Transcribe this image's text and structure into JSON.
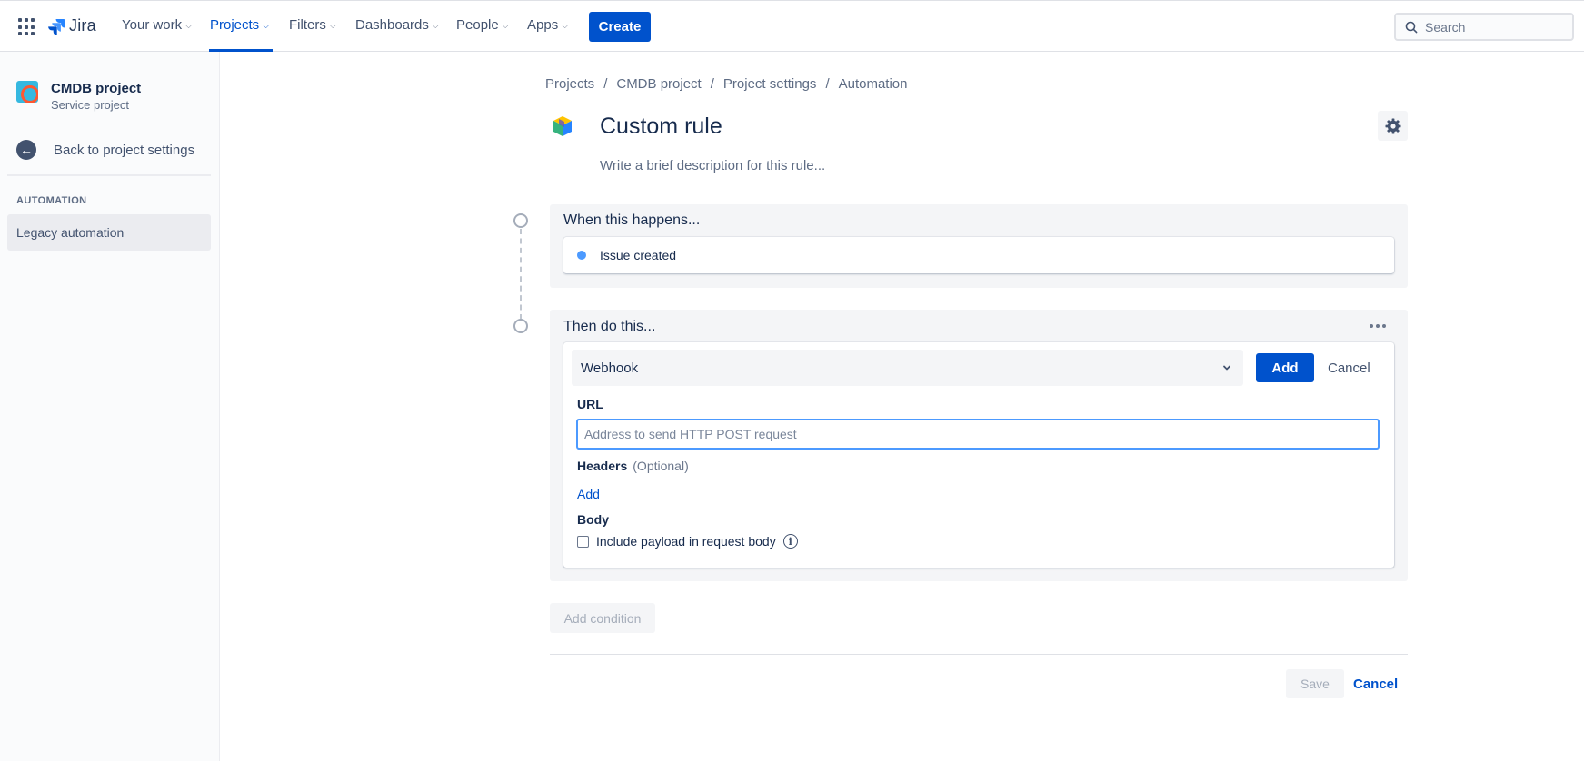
{
  "topnav": {
    "logo_text": "Jira",
    "items": [
      {
        "label": "Your work"
      },
      {
        "label": "Projects"
      },
      {
        "label": "Filters"
      },
      {
        "label": "Dashboards"
      },
      {
        "label": "People"
      },
      {
        "label": "Apps"
      }
    ],
    "active_item": "Projects",
    "create_label": "Create",
    "search_placeholder": "Search"
  },
  "sidebar": {
    "project_name": "CMDB project",
    "project_type": "Service project",
    "back_label": "Back to project settings",
    "section_title": "AUTOMATION",
    "items": [
      {
        "label": "Legacy automation",
        "selected": true
      }
    ]
  },
  "breadcrumb": [
    "Projects",
    "CMDB project",
    "Project settings",
    "Automation"
  ],
  "rule": {
    "title": "Custom rule",
    "description_placeholder": "Write a brief description for this rule..."
  },
  "trigger": {
    "heading": "When this happens...",
    "item": "Issue created"
  },
  "action": {
    "heading": "Then do this...",
    "selected": "Webhook",
    "add_label": "Add",
    "cancel_label": "Cancel",
    "url_label": "URL",
    "url_placeholder": "Address to send HTTP POST request",
    "url_value": "",
    "headers_label": "Headers",
    "headers_optional": "(Optional)",
    "headers_add": "Add",
    "body_label": "Body",
    "payload_checkbox_label": "Include payload in request body",
    "payload_checked": false
  },
  "footer": {
    "add_condition": "Add condition",
    "save": "Save",
    "cancel": "Cancel"
  },
  "colors": {
    "brand": "#0052cc",
    "focus": "#4c9aff",
    "panel": "#f4f5f7"
  }
}
